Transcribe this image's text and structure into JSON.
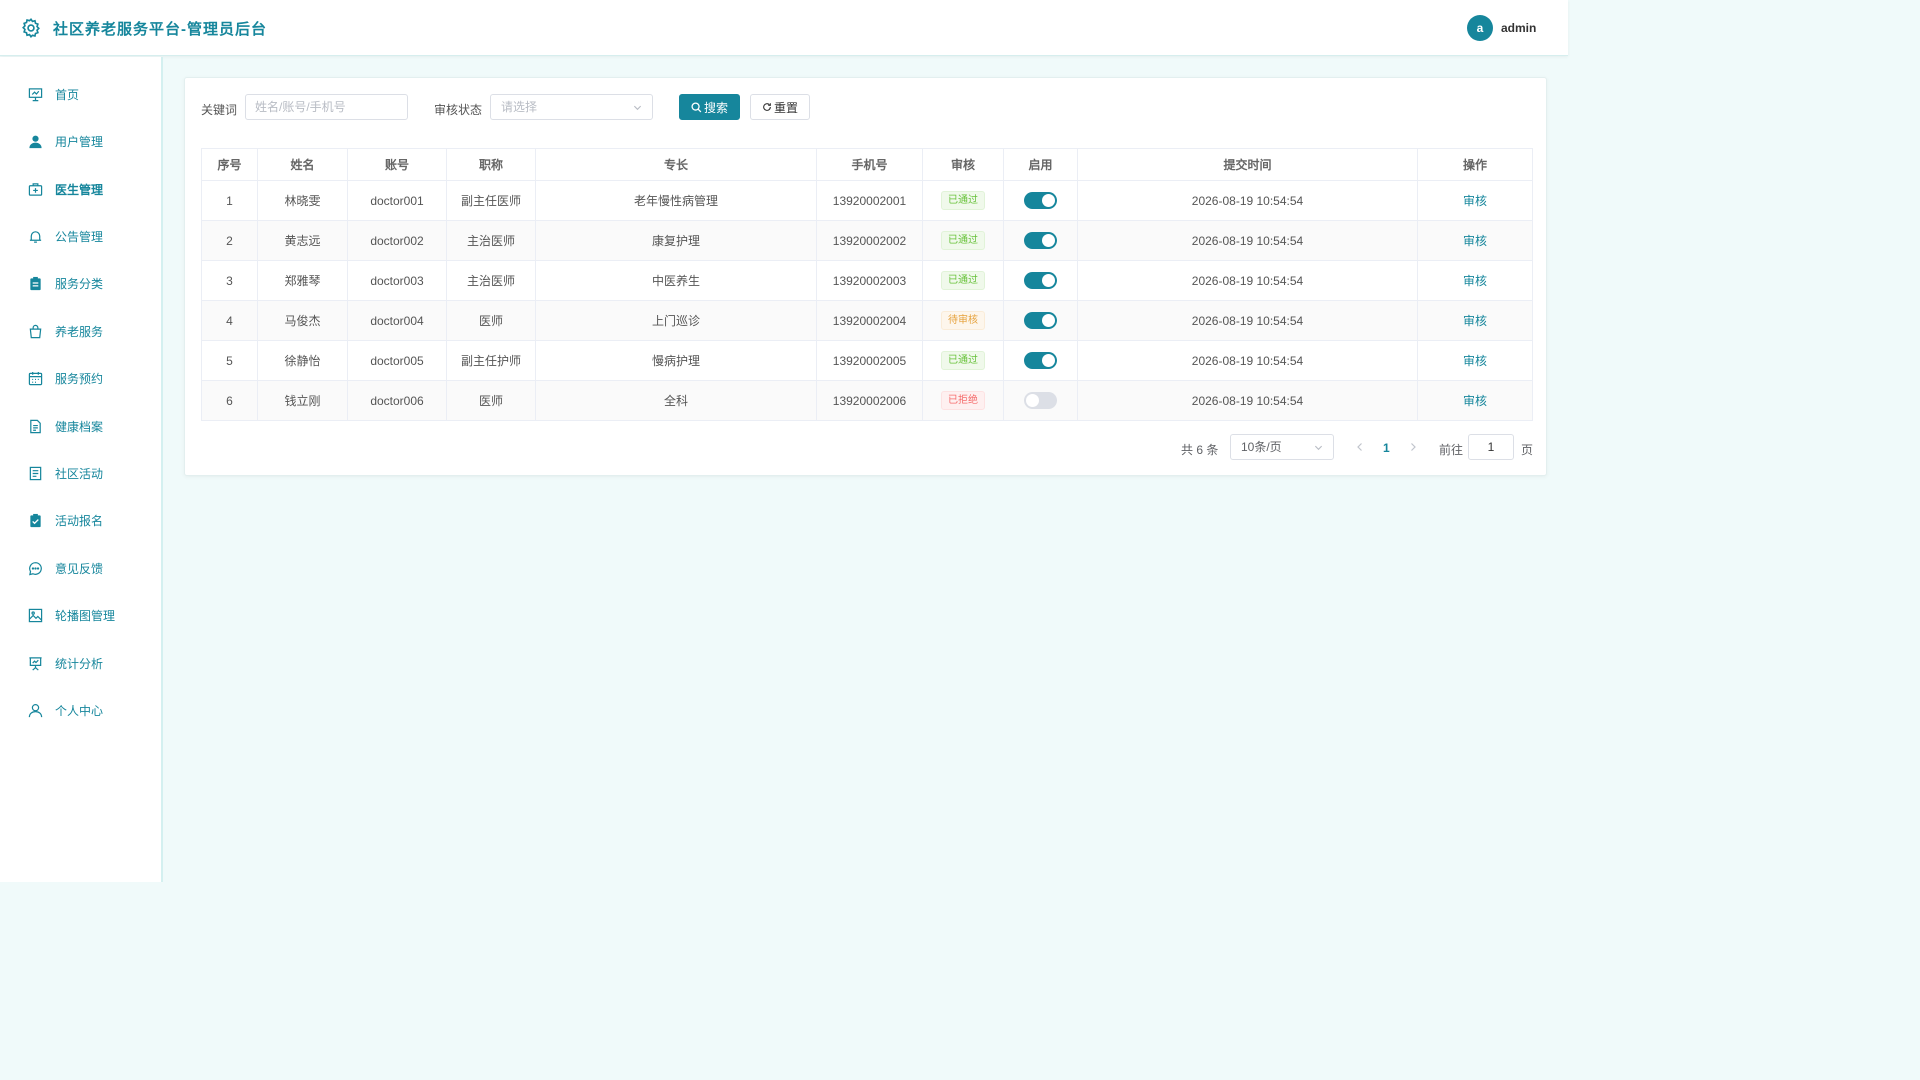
{
  "header": {
    "title": "社区养老服务平台-管理员后台",
    "avatar_letter": "a",
    "username": "admin"
  },
  "sidebar": {
    "items": [
      {
        "label": "首页",
        "icon": "presentation-icon"
      },
      {
        "label": "用户管理",
        "icon": "user-filled-icon"
      },
      {
        "label": "医生管理",
        "icon": "first-aid-kit-icon",
        "active": true
      },
      {
        "label": "公告管理",
        "icon": "bell-icon"
      },
      {
        "label": "服务分类",
        "icon": "clipboard-filled-icon"
      },
      {
        "label": "养老服务",
        "icon": "shopping-bag-icon"
      },
      {
        "label": "服务预约",
        "icon": "calendar-icon"
      },
      {
        "label": "健康档案",
        "icon": "document-icon"
      },
      {
        "label": "社区活动",
        "icon": "tickets-icon"
      },
      {
        "label": "活动报名",
        "icon": "checked-list-icon"
      },
      {
        "label": "意见反馈",
        "icon": "chat-dot-icon"
      },
      {
        "label": "轮播图管理",
        "icon": "picture-icon"
      },
      {
        "label": "统计分析",
        "icon": "data-board-icon"
      },
      {
        "label": "个人中心",
        "icon": "user-outline-icon"
      }
    ]
  },
  "filters": {
    "keyword_label": "关键词",
    "keyword_placeholder": "姓名/账号/手机号",
    "keyword_value": "",
    "status_label": "审核状态",
    "status_placeholder": "请选择",
    "search_label": "搜索",
    "reset_label": "重置"
  },
  "table": {
    "columns": [
      "序号",
      "姓名",
      "账号",
      "职称",
      "专长",
      "手机号",
      "审核",
      "启用",
      "提交时间",
      "操作"
    ],
    "rows": [
      {
        "index": "1",
        "name": "林晓雯",
        "account": "doctor001",
        "title": "副主任医师",
        "specialty": "老年慢性病管理",
        "phone": "13920002001",
        "audit": "已通过",
        "audit_state": "ok",
        "enabled": true,
        "time": "2026-08-19 10:54:54",
        "action": "审核"
      },
      {
        "index": "2",
        "name": "黄志远",
        "account": "doctor002",
        "title": "主治医师",
        "specialty": "康复护理",
        "phone": "13920002002",
        "audit": "已通过",
        "audit_state": "ok",
        "enabled": true,
        "time": "2026-08-19 10:54:54",
        "action": "审核"
      },
      {
        "index": "3",
        "name": "郑雅琴",
        "account": "doctor003",
        "title": "主治医师",
        "specialty": "中医养生",
        "phone": "13920002003",
        "audit": "已通过",
        "audit_state": "ok",
        "enabled": true,
        "time": "2026-08-19 10:54:54",
        "action": "审核"
      },
      {
        "index": "4",
        "name": "马俊杰",
        "account": "doctor004",
        "title": "医师",
        "specialty": "上门巡诊",
        "phone": "13920002004",
        "audit": "待审核",
        "audit_state": "pending",
        "enabled": true,
        "time": "2026-08-19 10:54:54",
        "action": "审核"
      },
      {
        "index": "5",
        "name": "徐静怡",
        "account": "doctor005",
        "title": "副主任护师",
        "specialty": "慢病护理",
        "phone": "13920002005",
        "audit": "已通过",
        "audit_state": "ok",
        "enabled": true,
        "time": "2026-08-19 10:54:54",
        "action": "审核"
      },
      {
        "index": "6",
        "name": "钱立刚",
        "account": "doctor006",
        "title": "医师",
        "specialty": "全科",
        "phone": "13920002006",
        "audit": "已拒绝",
        "audit_state": "rejected",
        "enabled": false,
        "time": "2026-08-19 10:54:54",
        "action": "审核"
      }
    ]
  },
  "pagination": {
    "total_text": "共 6 条",
    "page_size": "10条/页",
    "current_page": "1",
    "goto_label": "前往",
    "goto_value": "1",
    "page_suffix": "页"
  },
  "colors": {
    "accent": "#16869c",
    "background": "#f0fafa",
    "tag_ok": "#67c23a",
    "tag_pending": "#e6a23c",
    "tag_rejected": "#f56c6c"
  }
}
